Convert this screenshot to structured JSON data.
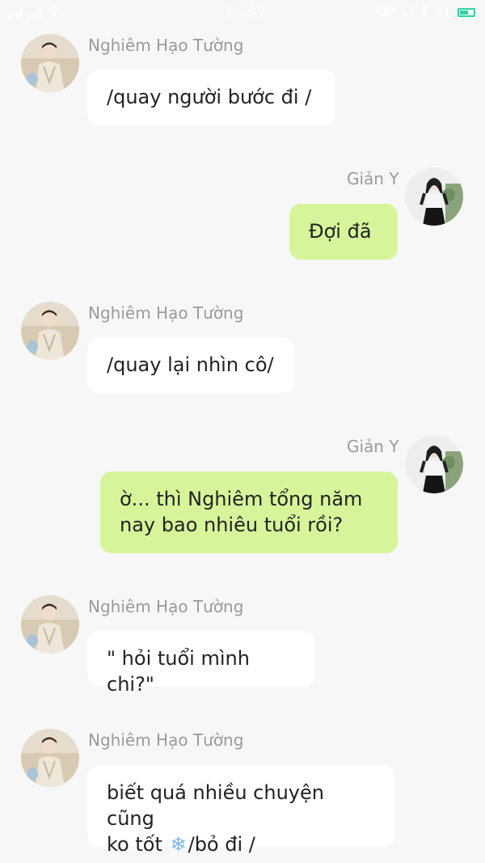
{
  "status_bar": {
    "time": "15:52",
    "battery": "51"
  },
  "messages": [
    {
      "sender": "Nghiêm Hạo Tường",
      "side": "left",
      "lines": [
        "/quay người bước đi /"
      ]
    },
    {
      "sender": "Giản Y",
      "side": "right",
      "lines": [
        "Đợi đã"
      ]
    },
    {
      "sender": "Nghiêm Hạo Tường",
      "side": "left",
      "lines": [
        "/quay lại nhìn cô/"
      ]
    },
    {
      "sender": "Giản Y",
      "side": "right",
      "lines": [
        "ờ... thì Nghiêm tổng năm",
        "nay bao nhiêu tuổi rồi?"
      ]
    },
    {
      "sender": "Nghiêm Hạo Tường",
      "side": "left",
      "lines": [
        "\" hỏi tuổi mình chi?\""
      ]
    },
    {
      "sender": "Nghiêm Hạo Tường",
      "side": "left",
      "lines": [
        "biết quá nhiều chuyện cũng",
        "ko tốt",
        "/bỏ đi /"
      ]
    }
  ],
  "icons": {
    "left_avatar": "man-avatar-photo",
    "right_avatar": "woman-avatar-photo",
    "emoji": "snowflake-emoji"
  },
  "colors": {
    "incoming_bubble": "#ffffff",
    "outgoing_bubble": "#d6f59a",
    "name_text": "#9a9a9a",
    "background": "#f7f7f7"
  }
}
